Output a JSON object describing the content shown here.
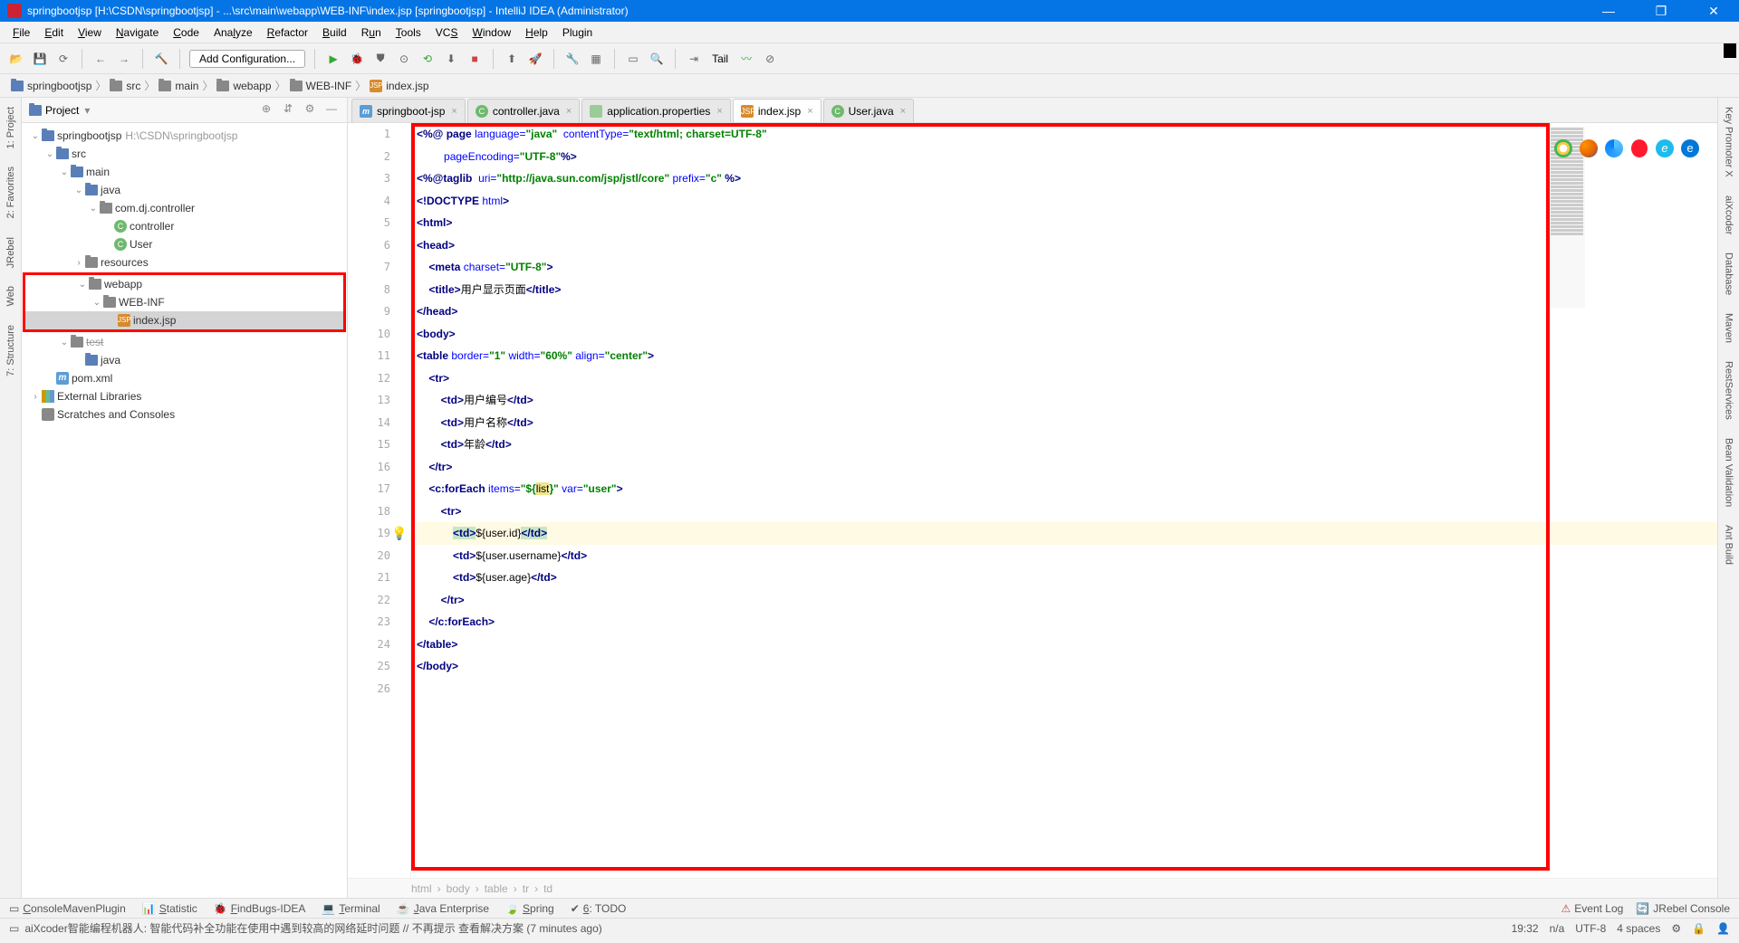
{
  "window": {
    "title": "springbootjsp [H:\\CSDN\\springbootjsp] - ...\\src\\main\\webapp\\WEB-INF\\index.jsp [springbootjsp] - IntelliJ IDEA (Administrator)"
  },
  "menu": [
    "File",
    "Edit",
    "View",
    "Navigate",
    "Code",
    "Analyze",
    "Refactor",
    "Build",
    "Run",
    "Tools",
    "VCS",
    "Window",
    "Help",
    "Plugin"
  ],
  "menu_underline": [
    0,
    0,
    0,
    0,
    0,
    3,
    0,
    0,
    1,
    0,
    2,
    0,
    0,
    -1
  ],
  "toolbar": {
    "config": "Add Configuration...",
    "tail": "Tail"
  },
  "breadcrumbs": [
    {
      "icon": "folder-blue",
      "label": "springbootjsp"
    },
    {
      "icon": "folder",
      "label": "src"
    },
    {
      "icon": "folder",
      "label": "main"
    },
    {
      "icon": "folder",
      "label": "webapp"
    },
    {
      "icon": "folder",
      "label": "WEB-INF"
    },
    {
      "icon": "jsp",
      "label": "index.jsp"
    }
  ],
  "project_panel": {
    "title": "Project",
    "tree": [
      {
        "depth": 0,
        "tw": "v",
        "icon": "folder-blue",
        "label": "springbootjsp",
        "path": "H:\\CSDN\\springbootjsp"
      },
      {
        "depth": 1,
        "tw": "v",
        "icon": "folder-blue",
        "label": "src"
      },
      {
        "depth": 2,
        "tw": "v",
        "icon": "folder-blue",
        "label": "main"
      },
      {
        "depth": 3,
        "tw": "v",
        "icon": "folder-blue",
        "label": "java"
      },
      {
        "depth": 4,
        "tw": "v",
        "icon": "folder",
        "label": "com.dj.controller"
      },
      {
        "depth": 5,
        "tw": "",
        "icon": "class-c",
        "label": "controller"
      },
      {
        "depth": 5,
        "tw": "",
        "icon": "class-c",
        "label": "User"
      },
      {
        "depth": 3,
        "tw": ">",
        "icon": "folder",
        "label": "resources"
      }
    ],
    "red_items": [
      {
        "depth": 3,
        "tw": "v",
        "icon": "folder",
        "label": "webapp"
      },
      {
        "depth": 4,
        "tw": "v",
        "icon": "folder",
        "label": "WEB-INF"
      },
      {
        "depth": 5,
        "tw": "",
        "icon": "jsp",
        "label": "index.jsp",
        "selected": true
      }
    ],
    "after": [
      {
        "depth": 2,
        "tw": "v",
        "icon": "folder",
        "label": "test",
        "struck": true
      },
      {
        "depth": 3,
        "tw": "",
        "icon": "folder-blue",
        "label": "java"
      },
      {
        "depth": 1,
        "tw": "",
        "icon": "m",
        "label": "pom.xml"
      },
      {
        "depth": 0,
        "tw": ">",
        "icon": "lib",
        "label": "External Libraries"
      },
      {
        "depth": 0,
        "tw": "",
        "icon": "scratch",
        "label": "Scratches and Consoles"
      }
    ]
  },
  "tabs": [
    {
      "icon": "m",
      "label": "springboot-jsp"
    },
    {
      "icon": "class-c",
      "label": "controller.java"
    },
    {
      "icon": "prop",
      "label": "application.properties"
    },
    {
      "icon": "jsp",
      "label": "index.jsp",
      "active": true
    },
    {
      "icon": "class-c",
      "label": "User.java"
    }
  ],
  "code": {
    "lines": [
      [
        {
          "c": "tag",
          "t": "<%@ "
        },
        {
          "c": "kw",
          "t": "page "
        },
        {
          "c": "attr",
          "t": "language="
        },
        {
          "c": "str",
          "t": "\"java\""
        },
        {
          "c": "txt",
          "t": "  "
        },
        {
          "c": "attr",
          "t": "contentType="
        },
        {
          "c": "str",
          "t": "\"text/html; charset=UTF-8\""
        }
      ],
      [
        {
          "c": "txt",
          "t": "         "
        },
        {
          "c": "attr",
          "t": "pageEncoding="
        },
        {
          "c": "str",
          "t": "\"UTF-8\""
        },
        {
          "c": "tag",
          "t": "%>"
        }
      ],
      [
        {
          "c": "tag",
          "t": "<%@"
        },
        {
          "c": "kw",
          "t": "taglib  "
        },
        {
          "c": "attr",
          "t": "uri="
        },
        {
          "c": "str",
          "t": "\"http://java.sun.com/jsp/jstl/core\""
        },
        {
          "c": "txt",
          "t": " "
        },
        {
          "c": "attr",
          "t": "prefix="
        },
        {
          "c": "str",
          "t": "\"c\""
        },
        {
          "c": "tag",
          "t": " %>"
        }
      ],
      [
        {
          "c": "tag",
          "t": "<!DOCTYPE "
        },
        {
          "c": "attr",
          "t": "html"
        },
        {
          "c": "tag",
          "t": ">"
        }
      ],
      [
        {
          "c": "tag",
          "t": "<html>"
        }
      ],
      [
        {
          "c": "tag",
          "t": "<head>"
        }
      ],
      [
        {
          "c": "txt",
          "t": "    "
        },
        {
          "c": "tag",
          "t": "<meta "
        },
        {
          "c": "attr",
          "t": "charset="
        },
        {
          "c": "str",
          "t": "\"UTF-8\""
        },
        {
          "c": "tag",
          "t": ">"
        }
      ],
      [
        {
          "c": "txt",
          "t": "    "
        },
        {
          "c": "tag",
          "t": "<title>"
        },
        {
          "c": "txt",
          "t": "用户显示页面"
        },
        {
          "c": "tag",
          "t": "</title>"
        }
      ],
      [
        {
          "c": "tag",
          "t": "</head>"
        }
      ],
      [
        {
          "c": "tag",
          "t": "<body>"
        }
      ],
      [
        {
          "c": "tag",
          "t": "<table "
        },
        {
          "c": "attr",
          "t": "border="
        },
        {
          "c": "str",
          "t": "\"1\""
        },
        {
          "c": "txt",
          "t": " "
        },
        {
          "c": "attr",
          "t": "width="
        },
        {
          "c": "str",
          "t": "\"60%\""
        },
        {
          "c": "txt",
          "t": " "
        },
        {
          "c": "attr",
          "t": "align="
        },
        {
          "c": "str",
          "t": "\"center\""
        },
        {
          "c": "tag",
          "t": ">"
        }
      ],
      [
        {
          "c": "txt",
          "t": "    "
        },
        {
          "c": "tag",
          "t": "<tr>"
        }
      ],
      [
        {
          "c": "txt",
          "t": "        "
        },
        {
          "c": "tag",
          "t": "<td>"
        },
        {
          "c": "txt",
          "t": "用户编号"
        },
        {
          "c": "tag",
          "t": "</td>"
        }
      ],
      [
        {
          "c": "txt",
          "t": "        "
        },
        {
          "c": "tag",
          "t": "<td>"
        },
        {
          "c": "txt",
          "t": "用户名称"
        },
        {
          "c": "tag",
          "t": "</td>"
        }
      ],
      [
        {
          "c": "txt",
          "t": "        "
        },
        {
          "c": "tag",
          "t": "<td>"
        },
        {
          "c": "txt",
          "t": "年龄"
        },
        {
          "c": "tag",
          "t": "</td>"
        }
      ],
      [
        {
          "c": "txt",
          "t": "    "
        },
        {
          "c": "tag",
          "t": "</tr>"
        }
      ],
      [
        {
          "c": "txt",
          "t": "    "
        },
        {
          "c": "tag",
          "t": "<c:forEach "
        },
        {
          "c": "attr",
          "t": "items="
        },
        {
          "c": "str",
          "t": "\"${"
        },
        {
          "c": "yel",
          "t": "list"
        },
        {
          "c": "str",
          "t": "}\""
        },
        {
          "c": "txt",
          "t": " "
        },
        {
          "c": "attr",
          "t": "var="
        },
        {
          "c": "str",
          "t": "\"user\""
        },
        {
          "c": "tag",
          "t": ">"
        }
      ],
      [
        {
          "c": "txt",
          "t": "        "
        },
        {
          "c": "tag",
          "t": "<tr>"
        }
      ],
      [
        {
          "c": "txt",
          "t": "            "
        },
        {
          "c": "grn-bg tag",
          "t": "<td>"
        },
        {
          "c": "txt",
          "t": "${user.id}"
        },
        {
          "c": "grn-bg tag",
          "t": "</td>"
        }
      ],
      [
        {
          "c": "txt",
          "t": "            "
        },
        {
          "c": "tag",
          "t": "<td>"
        },
        {
          "c": "txt",
          "t": "${user.username}"
        },
        {
          "c": "tag",
          "t": "</td>"
        }
      ],
      [
        {
          "c": "txt",
          "t": "            "
        },
        {
          "c": "tag",
          "t": "<td>"
        },
        {
          "c": "txt",
          "t": "${user.age}"
        },
        {
          "c": "tag",
          "t": "</td>"
        }
      ],
      [
        {
          "c": "txt",
          "t": "        "
        },
        {
          "c": "tag",
          "t": "</tr>"
        }
      ],
      [
        {
          "c": "txt",
          "t": "    "
        },
        {
          "c": "tag",
          "t": "</c:forEach>"
        }
      ],
      [
        {
          "c": "tag",
          "t": "</table>"
        }
      ],
      [
        {
          "c": "tag",
          "t": "</body>"
        }
      ],
      []
    ],
    "highlight_line": 18
  },
  "crumb_bottom": [
    "html",
    "body",
    "table",
    "tr",
    "td"
  ],
  "bottombar": {
    "left": [
      "ConsoleMavenPlugin",
      "Statistic",
      "FindBugs-IDEA",
      "Terminal",
      "Java Enterprise",
      "Spring",
      "6: TODO"
    ],
    "right": [
      "Event Log",
      "JRebel Console"
    ]
  },
  "left_tabs": [
    "1: Project",
    "2: Favorites",
    "JRebel",
    "Web",
    "7: Structure"
  ],
  "right_tabs": [
    "Key Promoter X",
    "aiXcoder",
    "Database",
    "Maven",
    "RestServices",
    "Bean Validation",
    "Ant Build"
  ],
  "status": {
    "msg": "aiXcoder智能编程机器人: 智能代码补全功能在使用中遇到较高的网络延时问题 // 不再提示 查看解决方案 (7 minutes ago)",
    "time": "19:32",
    "na": "n/a",
    "enc": "UTF-8",
    "indent": "4 spaces"
  }
}
